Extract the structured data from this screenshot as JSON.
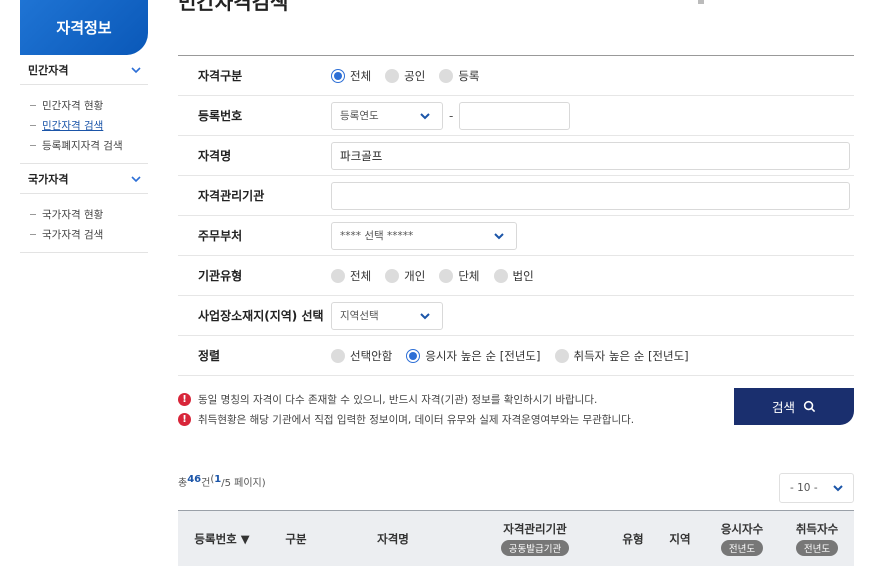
{
  "sidebar": {
    "header": "자격정보",
    "sections": [
      {
        "title": "민간자격",
        "items": [
          "민간자격 현황",
          "민간자격 검색",
          "등록폐지자격 검색"
        ]
      },
      {
        "title": "국가자격",
        "items": [
          "국가자격 현황",
          "국가자격 검색"
        ]
      }
    ]
  },
  "page_title": "민간자격검색",
  "form": {
    "qual_type": {
      "label": "자격구분",
      "options": [
        "전체",
        "공인",
        "등록"
      ],
      "selected": "전체"
    },
    "reg_no": {
      "label": "등록번호",
      "year_select": "등록연도",
      "separator": "-",
      "number_value": ""
    },
    "qual_name": {
      "label": "자격명",
      "value": "파크골프"
    },
    "agency": {
      "label": "자격관리기관",
      "value": ""
    },
    "ministry": {
      "label": "주무부처",
      "select_value": "**** 선택 *****"
    },
    "org_type": {
      "label": "기관유형",
      "options": [
        "전체",
        "개인",
        "단체",
        "법인"
      ]
    },
    "region": {
      "label": "사업장소재지(지역) 선택",
      "select_value": "지역선택"
    },
    "sort": {
      "label": "정렬",
      "options": [
        "선택안함",
        "응시자 높은 순 [전년도]",
        "취득자 높은 순 [전년도]"
      ],
      "selected": "응시자 높은 순 [전년도]"
    }
  },
  "notices": [
    "동일 명칭의 자격이 다수 존재할 수 있으니, 반드시 자격(기관) 정보를 확인하시기 바랍니다.",
    "취득현황은 해당 기관에서 직접 입력한 정보이며, 데이터 유무와 실제 자격운영여부와는 무관합니다."
  ],
  "search_button": "검색",
  "summary": {
    "prefix": "총 ",
    "count": "46",
    "unit": "건",
    "page_open": " (",
    "page_current": "1",
    "page_rest": "/5 페이지)"
  },
  "page_size": "- 10 -",
  "table": {
    "headers": {
      "reg_no": "등록번호 ▼",
      "type": "구분",
      "name": "자격명",
      "agency": "자격관리기관",
      "agency_pill": "공동발급기관",
      "org_type": "유형",
      "region": "지역",
      "applicants": "응시자수",
      "applicants_pill": "전년도",
      "acquirers": "취득자수",
      "acquirers_pill": "전년도"
    }
  },
  "colors": {
    "accent": "#2d6fd6",
    "brand_dark": "#1a2f6e",
    "alert": "#d8263a"
  }
}
